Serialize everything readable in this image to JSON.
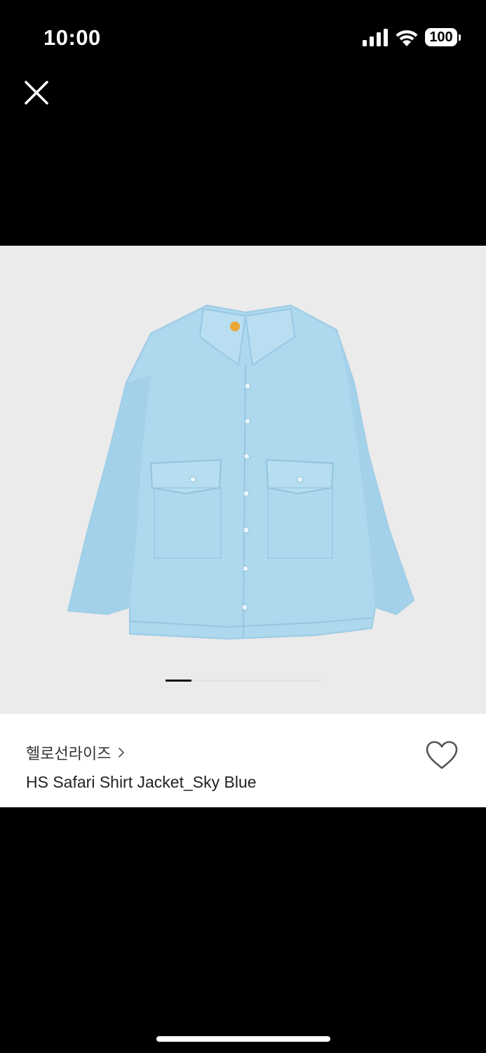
{
  "status_bar": {
    "time": "10:00",
    "battery_level": "100",
    "icons": [
      "signal-icon",
      "wifi-icon",
      "battery-icon"
    ]
  },
  "header": {
    "close_icon": "close-icon"
  },
  "gallery": {
    "image_description_icon": "product-photo",
    "current_index": 1,
    "page_count": 6,
    "colors": {
      "background": "#ebebeb",
      "shirt": "#aed8ee",
      "pager_active": "#111111",
      "pager_track": "#e3e3e3"
    }
  },
  "product": {
    "brand": "헬로선라이즈",
    "name": "HS Safari Shirt Jacket_Sky Blue",
    "wishlist_icon": "heart-icon"
  },
  "colors": {
    "screen_background": "#000000",
    "panel_background": "#ffffff",
    "text_primary": "#222222"
  }
}
